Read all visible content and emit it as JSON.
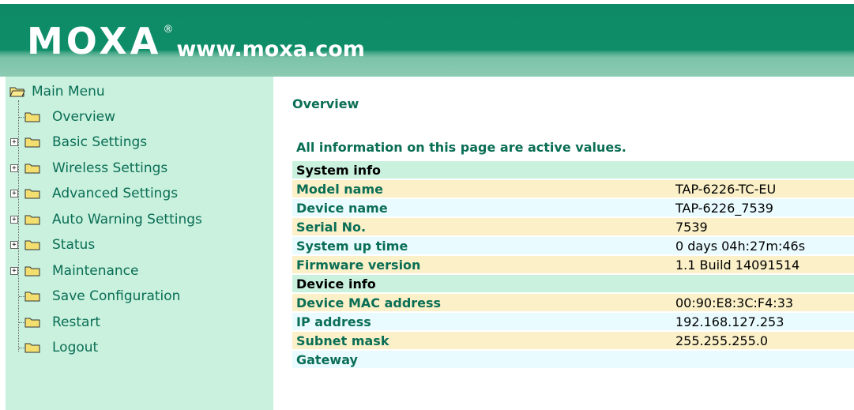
{
  "brand": {
    "logo_text": "MOXA",
    "registered_mark": "®",
    "url": "www.moxa.com",
    "colors": {
      "header": "#0f8d68",
      "sidebar": "#c9f1de",
      "label_green": "#0a6e55"
    }
  },
  "sidebar": {
    "root_label": "Main Menu",
    "items": [
      {
        "label": "Overview",
        "expandable": false
      },
      {
        "label": "Basic Settings",
        "expandable": true
      },
      {
        "label": "Wireless Settings",
        "expandable": true
      },
      {
        "label": "Advanced Settings",
        "expandable": true
      },
      {
        "label": "Auto Warning Settings",
        "expandable": true
      },
      {
        "label": "Status",
        "expandable": true
      },
      {
        "label": "Maintenance",
        "expandable": true
      },
      {
        "label": "Save Configuration",
        "expandable": false
      },
      {
        "label": "Restart",
        "expandable": false
      },
      {
        "label": "Logout",
        "expandable": false
      }
    ]
  },
  "main": {
    "title": "Overview",
    "notice": "All information on this page are active values.",
    "sections": [
      {
        "heading": "System info",
        "rows": [
          {
            "key": "Model name",
            "value": "TAP-6226-TC-EU"
          },
          {
            "key": "Device name",
            "value": "TAP-6226_7539"
          },
          {
            "key": "Serial No.",
            "value": "7539"
          },
          {
            "key": "System up time",
            "value": "0 days 04h:27m:46s"
          },
          {
            "key": "Firmware version",
            "value": "1.1 Build 14091514"
          }
        ]
      },
      {
        "heading": "Device info",
        "rows": [
          {
            "key": "Device MAC address",
            "value": "00:90:E8:3C:F4:33"
          },
          {
            "key": "IP address",
            "value": "192.168.127.253"
          },
          {
            "key": "Subnet mask",
            "value": "255.255.255.0"
          },
          {
            "key": "Gateway",
            "value": ""
          }
        ]
      }
    ]
  }
}
